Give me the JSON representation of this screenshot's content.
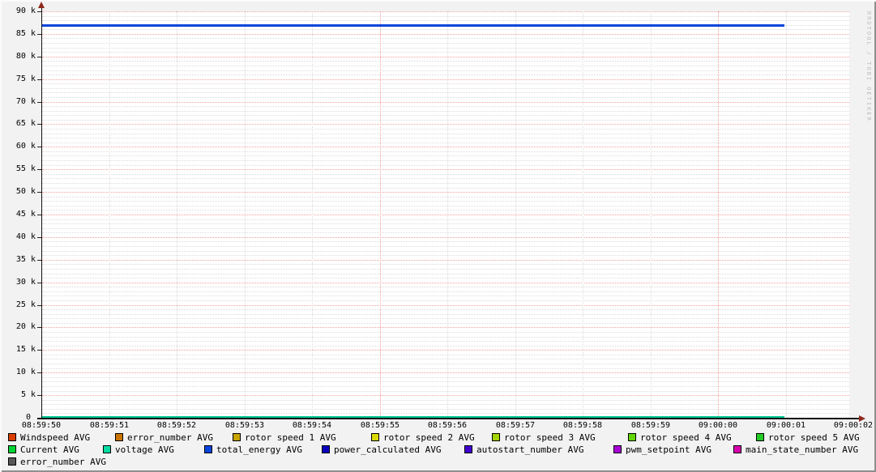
{
  "watermark": "RRDTOOL / TOBI OETIKER",
  "chart_data": {
    "type": "line",
    "title": "",
    "xlabel": "",
    "ylabel": "",
    "ylim": [
      0,
      90000
    ],
    "y_major_step": 5000,
    "y_minor_step": 1000,
    "grid": {
      "on": true,
      "minor_color": "#DCDCDC",
      "major_color": "#F2A0A0"
    },
    "legend_position": "bottom",
    "y_ticks": [
      {
        "value": 90000,
        "label": "90 k"
      },
      {
        "value": 85000,
        "label": "85 k"
      },
      {
        "value": 80000,
        "label": "80 k"
      },
      {
        "value": 75000,
        "label": "75 k"
      },
      {
        "value": 70000,
        "label": "70 k"
      },
      {
        "value": 65000,
        "label": "65 k"
      },
      {
        "value": 60000,
        "label": "60 k"
      },
      {
        "value": 55000,
        "label": "55 k"
      },
      {
        "value": 50000,
        "label": "50 k"
      },
      {
        "value": 45000,
        "label": "45 k"
      },
      {
        "value": 40000,
        "label": "40 k"
      },
      {
        "value": 35000,
        "label": "35 k"
      },
      {
        "value": 30000,
        "label": "30 k"
      },
      {
        "value": 25000,
        "label": "25 k"
      },
      {
        "value": 20000,
        "label": "20 k"
      },
      {
        "value": 15000,
        "label": "15 k"
      },
      {
        "value": 10000,
        "label": "10 k"
      },
      {
        "value": 5000,
        "label": "5 k"
      },
      {
        "value": 0,
        "label": "0"
      }
    ],
    "x_ticks": [
      {
        "label": "08:59:50",
        "major": false
      },
      {
        "label": "08:59:51",
        "major": false
      },
      {
        "label": "08:59:52",
        "major": false
      },
      {
        "label": "08:59:53",
        "major": false
      },
      {
        "label": "08:59:54",
        "major": false
      },
      {
        "label": "08:59:55",
        "major": true
      },
      {
        "label": "08:59:56",
        "major": false
      },
      {
        "label": "08:59:57",
        "major": false
      },
      {
        "label": "08:59:58",
        "major": false
      },
      {
        "label": "08:59:59",
        "major": false
      },
      {
        "label": "09:00:00",
        "major": true
      },
      {
        "label": "09:00:01",
        "major": false
      },
      {
        "label": "09:00:02",
        "major": false
      }
    ],
    "series": [
      {
        "name": "Current AVG",
        "color": "#00D434",
        "value": 0,
        "from": "08:59:50",
        "to": "09:00:01",
        "line_width": 2
      },
      {
        "name": "voltage AVG",
        "color": "#00C896",
        "value": 0,
        "from": "08:59:50",
        "to": "09:00:01",
        "line_width": 2
      },
      {
        "name": "total_energy AVG",
        "color": "#0845DC",
        "value": 86800,
        "from": "08:59:50",
        "to": "09:00:01",
        "line_width": 3
      }
    ],
    "legend_rows": [
      [
        {
          "label": "Windspeed AVG",
          "color": "#D73E00"
        },
        {
          "label": "error_number AVG",
          "color": "#C97400"
        },
        {
          "label": "rotor speed 1 AVG",
          "color": "#C9A400"
        },
        {
          "label": "rotor speed 2 AVG",
          "color": "#D9D900"
        },
        {
          "label": "rotor speed 3 AVG",
          "color": "#A4D400"
        },
        {
          "label": "rotor speed 4 AVG",
          "color": "#63D600"
        },
        {
          "label": "rotor speed 5 AVG",
          "color": "#25CB25"
        }
      ],
      [
        {
          "label": "Current AVG",
          "color": "#00D434"
        },
        {
          "label": "voltage AVG",
          "color": "#00DCA4"
        },
        {
          "label": "total_energy AVG",
          "color": "#0845DC"
        },
        {
          "label": "power_calculated AVG",
          "color": "#0B00BE"
        },
        {
          "label": "autostart_number AVG",
          "color": "#4100CE"
        },
        {
          "label": "pwm_setpoint AVG",
          "color": "#A800D6"
        },
        {
          "label": "main_state_number AVG",
          "color": "#D800AC"
        }
      ],
      [
        {
          "label": "error_number AVG",
          "color": "#585858"
        }
      ]
    ]
  }
}
